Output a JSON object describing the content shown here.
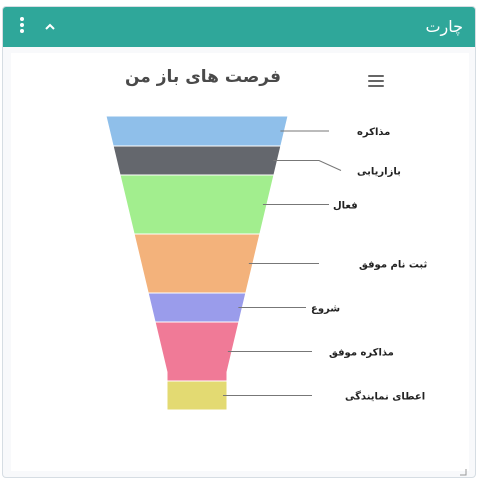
{
  "panel": {
    "title": "چارت",
    "menu_icon": "vertical-dots-icon",
    "collapse_icon": "chevron-up-icon",
    "resize_icon": "resize-handle-icon"
  },
  "chart_menu_icon": "hamburger-icon",
  "colors": {
    "header": "#2fa79a"
  },
  "chart_data": {
    "type": "funnel",
    "title": "فرصت های باز من",
    "stages": [
      {
        "label": "مذاکره",
        "color": "#8fbfea"
      },
      {
        "label": "بازاریابی",
        "color": "#64676d"
      },
      {
        "label": "فعال",
        "color": "#a2ee8e"
      },
      {
        "label": "ثبت نام موفق",
        "color": "#f3b27b"
      },
      {
        "label": "شروع",
        "color": "#9a9ceb"
      },
      {
        "label": "مذاکره موفق",
        "color": "#f07a97"
      },
      {
        "label": "اعطای نمایندگی",
        "color": "#e3da72"
      }
    ]
  }
}
